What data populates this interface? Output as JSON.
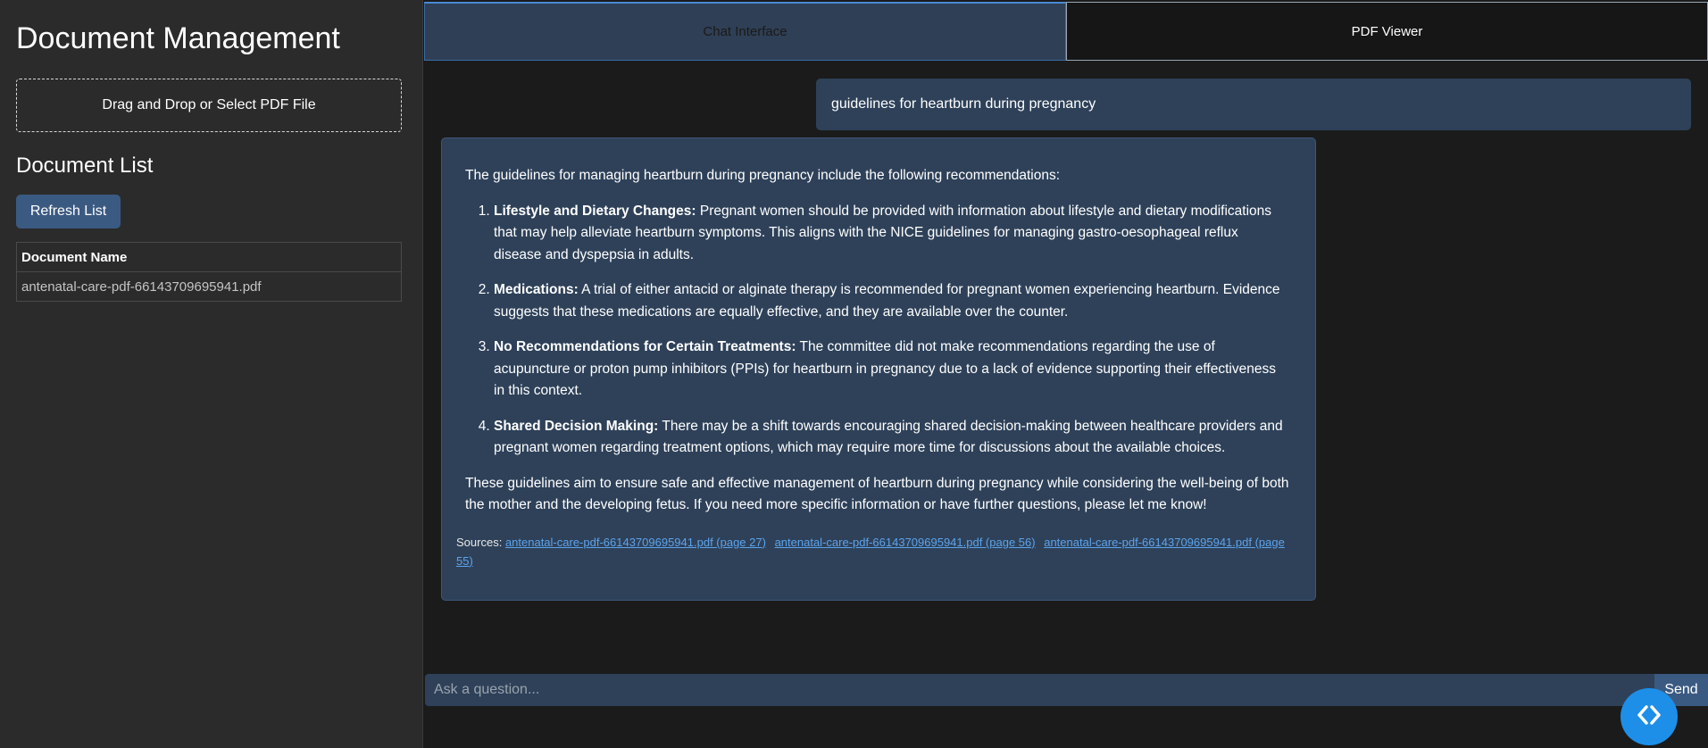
{
  "sidebar": {
    "title": "Document Management",
    "dropzone_label": "Drag and Drop or Select PDF File",
    "list_title": "Document List",
    "refresh_label": "Refresh List",
    "table": {
      "header": "Document Name",
      "rows": [
        "antenatal-care-pdf-66143709695941.pdf"
      ]
    }
  },
  "tabs": [
    {
      "label": "Chat Interface",
      "active": true
    },
    {
      "label": "PDF Viewer",
      "active": false
    }
  ],
  "chat": {
    "user_message": "guidelines for heartburn during pregnancy",
    "bot": {
      "intro": "The guidelines for managing heartburn during pregnancy include the following recommendations:",
      "items": [
        {
          "title": "Lifestyle and Dietary Changes:",
          "text": " Pregnant women should be provided with information about lifestyle and dietary modifications that may help alleviate heartburn symptoms. This aligns with the NICE guidelines for managing gastro-oesophageal reflux disease and dyspepsia in adults."
        },
        {
          "title": "Medications:",
          "text": " A trial of either antacid or alginate therapy is recommended for pregnant women experiencing heartburn. Evidence suggests that these medications are equally effective, and they are available over the counter."
        },
        {
          "title": "No Recommendations for Certain Treatments:",
          "text": " The committee did not make recommendations regarding the use of acupuncture or proton pump inhibitors (PPIs) for heartburn in pregnancy due to a lack of evidence supporting their effectiveness in this context."
        },
        {
          "title": "Shared Decision Making:",
          "text": " There may be a shift towards encouraging shared decision-making between healthcare providers and pregnant women regarding treatment options, which may require more time for discussions about the available choices."
        }
      ],
      "outro": "These guidelines aim to ensure safe and effective management of heartburn during pregnancy while considering the well-being of both the mother and the developing fetus. If you need more specific information or have further questions, please let me know!",
      "sources_label": "Sources:",
      "sources": [
        "antenatal-care-pdf-66143709695941.pdf (page 27)",
        "antenatal-care-pdf-66143709695941.pdf (page 56)",
        "antenatal-care-pdf-66143709695941.pdf (page 55)"
      ]
    }
  },
  "input": {
    "placeholder": "Ask a question...",
    "send_label": "Send"
  },
  "colors": {
    "accent": "#3b5a82",
    "bubble": "#2e4159",
    "link": "#5da3ea",
    "fab": "#1d8fe8"
  },
  "icons": {
    "fab": "code-brackets-icon"
  }
}
